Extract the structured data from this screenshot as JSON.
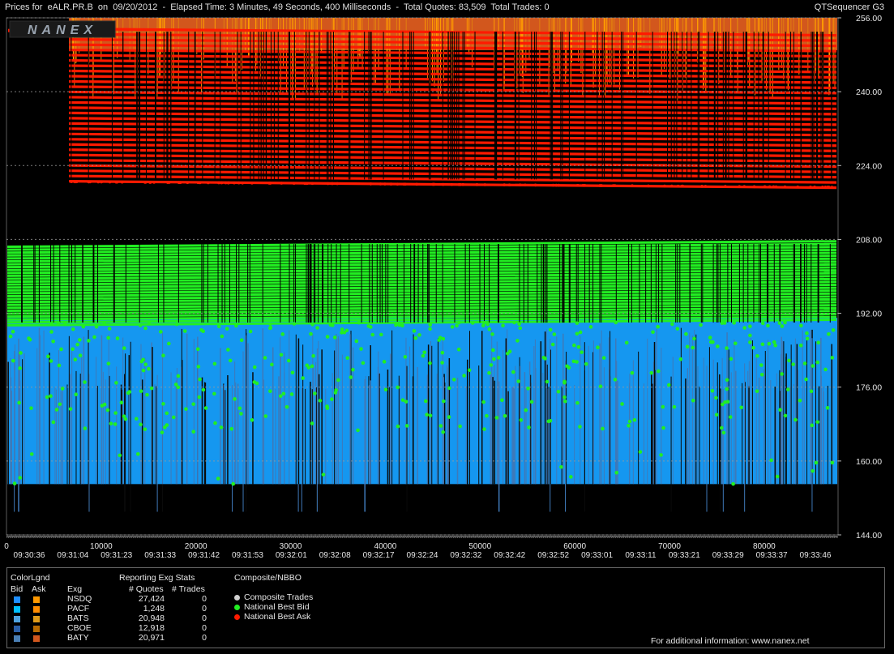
{
  "header": {
    "title": "Prices for  eALR.PR.B  on  09/20/2012  -  Elapsed Time: 3 Minutes, 49 Seconds, 400 Milliseconds  -  Total Quotes: 83,509  Total Trades: 0",
    "app_name": "QTSequencer G3"
  },
  "logo_text": "NANEX",
  "chart_data": {
    "type": "scatter",
    "title": "",
    "xlabel": "",
    "ylabel": "",
    "y_ticks": [
      "256.00",
      "240.00",
      "224.00",
      "208.00",
      "192.00",
      "176.00",
      "160.00",
      "144.00"
    ],
    "ylim": [
      144,
      256
    ],
    "xlim": [
      0,
      87800
    ],
    "x_ticks": [
      "0",
      "10000",
      "20000",
      "30000",
      "40000",
      "50000",
      "60000",
      "70000",
      "80000"
    ],
    "time_ticks": [
      "09:30:36",
      "09:31:04",
      "09:31:23",
      "09:31:33",
      "09:31:42",
      "09:31:53",
      "09:32:01",
      "09:32:08",
      "09:32:17",
      "09:32:24",
      "09:32:32",
      "09:32:42",
      "09:32:52",
      "09:33:01",
      "09:33:11",
      "09:33:21",
      "09:33:29",
      "09:33:37",
      "09:33:46"
    ],
    "grid": true,
    "series": [
      {
        "name": "National Best Bid",
        "color": "#22ee22",
        "band": [
          167,
          207
        ]
      },
      {
        "name": "National Best Ask",
        "color": "#ff1a00",
        "band": [
          220,
          253
        ]
      },
      {
        "name": "Composite Trades",
        "color": "#c8c8c8",
        "count": 0
      }
    ],
    "exchange_bid_band": [
      155,
      191
    ],
    "exchange_ask_band": [
      249,
      256
    ]
  },
  "legend": {
    "colorlegend_title": "ColorLgnd",
    "bid_label": "Bid",
    "ask_label": "Ask",
    "exg_header": "Exg",
    "stats_title": "Reporting Exg Stats",
    "quotes_header": "# Quotes",
    "trades_header": "# Trades",
    "composite_title": "Composite/NBBO",
    "exchanges": [
      {
        "name": "NSDQ",
        "quotes": "27,424",
        "trades": "0",
        "bid_color": "#1e8fff",
        "ask_color": "#ff9900"
      },
      {
        "name": "PACF",
        "quotes": "1,248",
        "trades": "0",
        "bid_color": "#00bfff",
        "ask_color": "#ff8c00"
      },
      {
        "name": "BATS",
        "quotes": "20,948",
        "trades": "0",
        "bid_color": "#4fa3e0",
        "ask_color": "#e09b1a"
      },
      {
        "name": "CBOE",
        "quotes": "12,918",
        "trades": "0",
        "bid_color": "#2a5fa8",
        "ask_color": "#b86a00"
      },
      {
        "name": "BATY",
        "quotes": "20,971",
        "trades": "0",
        "bid_color": "#4a7fb5",
        "ask_color": "#d2571d"
      }
    ],
    "composite": [
      {
        "label": "Composite Trades",
        "color": "#d0d0d0"
      },
      {
        "label": "National Best Bid",
        "color": "#22ee22"
      },
      {
        "label": "National Best Ask",
        "color": "#ff1a00"
      }
    ],
    "footer": "For additional information: www.nanex.net"
  }
}
